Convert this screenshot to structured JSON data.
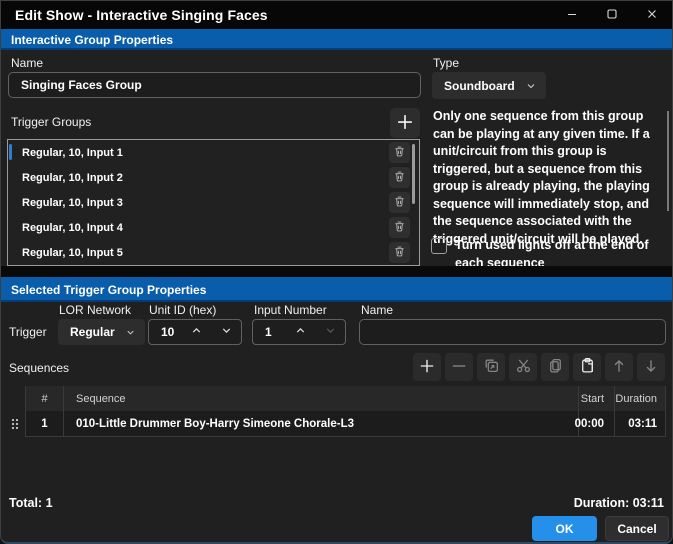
{
  "window": {
    "title": "Edit Show - Interactive Singing Faces",
    "caption_buttons": [
      "minimize",
      "maximize",
      "close"
    ]
  },
  "group_props": {
    "header": "Interactive Group Properties",
    "name_label": "Name",
    "name_value": "Singing Faces Group",
    "type_label": "Type",
    "type_value": "Soundboard",
    "trigger_groups_label": "Trigger Groups",
    "trigger_groups": [
      {
        "label": "Regular, 10, Input 1",
        "selected": true
      },
      {
        "label": "Regular, 10, Input 2"
      },
      {
        "label": "Regular, 10, Input 3"
      },
      {
        "label": "Regular, 10, Input 4"
      },
      {
        "label": "Regular, 10, Input 5"
      }
    ],
    "description": "Only one sequence from this group can be playing at any given time. If a unit/circuit from this group is triggered, but a sequence from this group is already playing, the playing sequence will immediately stop, and the sequence associated with the triggered unit/circuit will be played.",
    "lights_off_label": "Turn used lights off at the end of each sequence",
    "lights_off_checked": false
  },
  "trigger_props": {
    "header": "Selected Trigger Group Properties",
    "row_label": "Trigger",
    "lor_network_label": "LOR Network",
    "lor_network_value": "Regular",
    "unit_id_label": "Unit ID (hex)",
    "unit_id_value": "10",
    "input_number_label": "Input Number",
    "input_number_value": "1",
    "name_label": "Name",
    "name_value": ""
  },
  "sequences": {
    "label": "Sequences",
    "toolbar_icons": [
      "add",
      "remove",
      "duplicate",
      "cut",
      "copy",
      "paste",
      "move-up",
      "move-down"
    ],
    "columns": {
      "num": "#",
      "sequence": "Sequence",
      "start": "Start",
      "duration": "Duration"
    },
    "rows": [
      {
        "num": "1",
        "sequence": "010-Little Drummer Boy-Harry Simeone Chorale-L3",
        "start": "00:00",
        "duration": "03:11"
      }
    ],
    "total_label": "Total: 1",
    "duration_total_label": "Duration: 03:11"
  },
  "footer": {
    "ok_label": "OK",
    "cancel_label": "Cancel"
  },
  "colors": {
    "section_header_blue": "#0a5dab",
    "ok_button_blue": "#2590ea",
    "selection_accent_blue": "#2e7fd2",
    "window_background": "#202020",
    "titlebar_background": "#070707"
  }
}
